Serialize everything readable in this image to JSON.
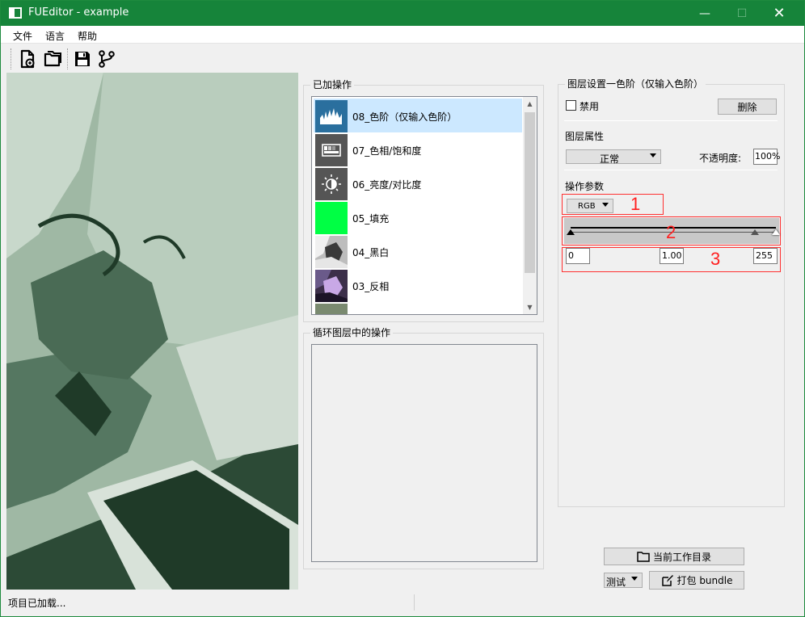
{
  "window": {
    "title": "FUEditor - example",
    "minimize_glyph": "—",
    "maximize_glyph": "☐",
    "close_glyph": "✕"
  },
  "menu": {
    "items": [
      {
        "label": "文件"
      },
      {
        "label": "语言"
      },
      {
        "label": "帮助"
      }
    ]
  },
  "toolbar": {
    "icons": [
      "new-file-icon",
      "open-folder-icon",
      "save-icon",
      "branch-icon"
    ]
  },
  "operations": {
    "title": "已加操作",
    "items": [
      {
        "label": "08_色阶（仅输入色阶）",
        "icon": "levels-icon",
        "selected": true,
        "thumb_color": "#2a6f9e"
      },
      {
        "label": "07_色相/饱和度",
        "icon": "hue-saturation-icon",
        "selected": false,
        "thumb_color": "#555555"
      },
      {
        "label": "06_亮度/对比度",
        "icon": "brightness-icon",
        "selected": false,
        "thumb_color": "#555555"
      },
      {
        "label": "05_填充",
        "icon": "fill-icon",
        "selected": false,
        "thumb_color": "#00ff44"
      },
      {
        "label": "04_黑白",
        "icon": "black-white-thumbnail",
        "selected": false,
        "thumb_color": "#7a7a7a"
      },
      {
        "label": "03_反相",
        "icon": "invert-thumbnail",
        "selected": false,
        "thumb_color": "#5a4a6a"
      }
    ]
  },
  "loop": {
    "title": "循环图层中的操作"
  },
  "layer_settings": {
    "title": "图层设置一色阶（仅输入色阶）",
    "disable_label": "禁用",
    "disable_checked": false,
    "delete_label": "删除",
    "properties_title": "图层属性",
    "blend_mode": "正常",
    "opacity_label": "不透明度:",
    "opacity_value": "100%",
    "params_title": "操作参数",
    "channel": "RGB",
    "input_black": "0",
    "input_gamma": "1.00",
    "input_white": "255",
    "annotations": [
      "1",
      "2",
      "3"
    ]
  },
  "bottom": {
    "workdir_label": "当前工作目录",
    "mode_value": "测试",
    "bundle_label": "打包 bundle"
  },
  "status": {
    "text": "项目已加载..."
  },
  "colors": {
    "titlebar": "#16843a",
    "selection": "#cce8ff",
    "annotation": "#ff2020"
  }
}
